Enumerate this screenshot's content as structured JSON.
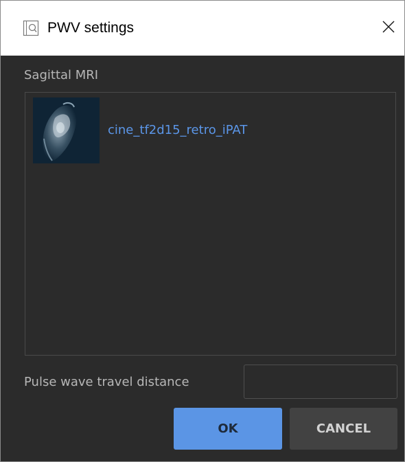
{
  "window": {
    "title": "PWV settings",
    "close_icon": "close-icon",
    "app_icon": "search-window-icon"
  },
  "sagittal": {
    "label": "Sagittal MRI",
    "items": [
      {
        "name": "cine_tf2d15_retro_iPAT",
        "thumbnail": "mri-thumbnail"
      }
    ]
  },
  "distance": {
    "label": "Pulse wave travel distance",
    "value": "",
    "placeholder": ""
  },
  "buttons": {
    "ok": "OK",
    "cancel": "CANCEL"
  },
  "colors": {
    "background": "#2b2b2b",
    "accent": "#5b95e5",
    "link": "#5b96e8",
    "label": "#b7b7b7",
    "secondary_button": "#424242"
  }
}
